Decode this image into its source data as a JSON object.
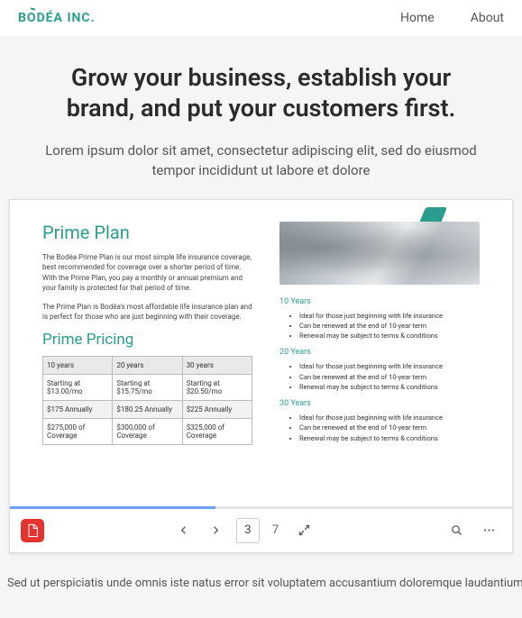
{
  "header": {
    "brand": "BODÉA INC.",
    "nav": {
      "home": "Home",
      "about": "About"
    }
  },
  "hero": {
    "title": "Grow your business, establish your brand, and put your customers first.",
    "subtitle": "Lorem ipsum dolor sit amet, consectetur adipiscing elit, sed do eiusmod tempor incididunt ut labore et dolore"
  },
  "pdf": {
    "plan_title": "Prime Plan",
    "desc1": "The Bodéa Prime Plan is our most simple life insurance coverage, best recommended for coverage over a shorter period of time. With the Prime Plan, you pay a monthly or annual premium and your family is protected for that period of time.",
    "desc2": "The Prime Plan is Bodéa's most affordable life insurance plan and is perfect for those who are just beginning with their coverage.",
    "pricing_title": "Prime Pricing",
    "table": {
      "headers": [
        "10 years",
        "20 years",
        "30 years"
      ],
      "rows": [
        [
          "Starting at $13.00/mo",
          "Starting at $15.75/mo",
          "Starting at $20.50/mo"
        ],
        [
          "$175 Annually",
          "$180.25 Annually",
          "$225 Annually"
        ],
        [
          "$275,000 of Coverage",
          "$300,000 of Coverage",
          "$325,000 of Coverage"
        ]
      ]
    },
    "sections": [
      {
        "title": "10 Years",
        "items": [
          "Ideal for those just beginning with life insurance",
          "Can be renewed at the end of 10-year term",
          "Renewal may be subject to terms & conditions"
        ]
      },
      {
        "title": "20 Years",
        "items": [
          "Ideal for those just beginning with life insurance",
          "Can be renewed at the end of 10-year term",
          "Renewal may be subject to terms & conditions"
        ]
      },
      {
        "title": "30 Years",
        "items": [
          "Ideal for those just beginning with life insurance",
          "Can be renewed at the end of 10-year term",
          "Renewal may be subject to terms & conditions"
        ]
      }
    ],
    "toolbar": {
      "current_page": "3",
      "total_pages": "7"
    }
  },
  "footer": {
    "text": "Sed ut perspiciatis unde omnis iste natus error sit voluptatem accusantium doloremque laudantium,"
  }
}
